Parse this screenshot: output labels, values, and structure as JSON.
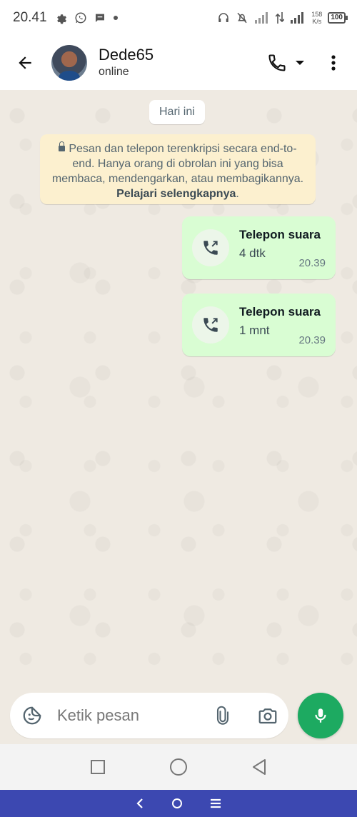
{
  "status_bar": {
    "time": "20.41",
    "net_speed_value": "158",
    "net_speed_unit": "K/s",
    "battery": "100"
  },
  "header": {
    "contact_name": "Dede65",
    "contact_status": "online"
  },
  "chat": {
    "date_chip": "Hari ini",
    "encryption_notice": "Pesan dan telepon terenkripsi secara end-to-end. Hanya orang di obrolan ini yang bisa membaca, mendengarkan, atau membagikannya.",
    "encryption_link": "Pelajari selengkapnya",
    "messages": [
      {
        "title": "Telepon suara",
        "duration": "4 dtk",
        "time": "20.39"
      },
      {
        "title": "Telepon suara",
        "duration": "1 mnt",
        "time": "20.39"
      }
    ]
  },
  "composer": {
    "placeholder": "Ketik pesan"
  },
  "colors": {
    "accent_green": "#1daa61",
    "outgoing_bubble": "#d9fdd3",
    "notice_bg": "#fcf0cf",
    "host_bar": "#3c48b1"
  },
  "icons": {
    "status": [
      "gear-icon",
      "whatsapp-icon",
      "message-icon",
      "dot-icon",
      "headset-icon",
      "mute-icon",
      "signal-icon",
      "data-arrows-icon",
      "battery-icon"
    ],
    "header": [
      "back-arrow-icon",
      "phone-icon",
      "dropdown-icon",
      "more-vert-icon"
    ],
    "composer": [
      "sticker-icon",
      "attach-icon",
      "camera-icon",
      "mic-icon"
    ],
    "navigation": [
      "recent-apps-icon",
      "home-icon",
      "back-icon"
    ]
  }
}
